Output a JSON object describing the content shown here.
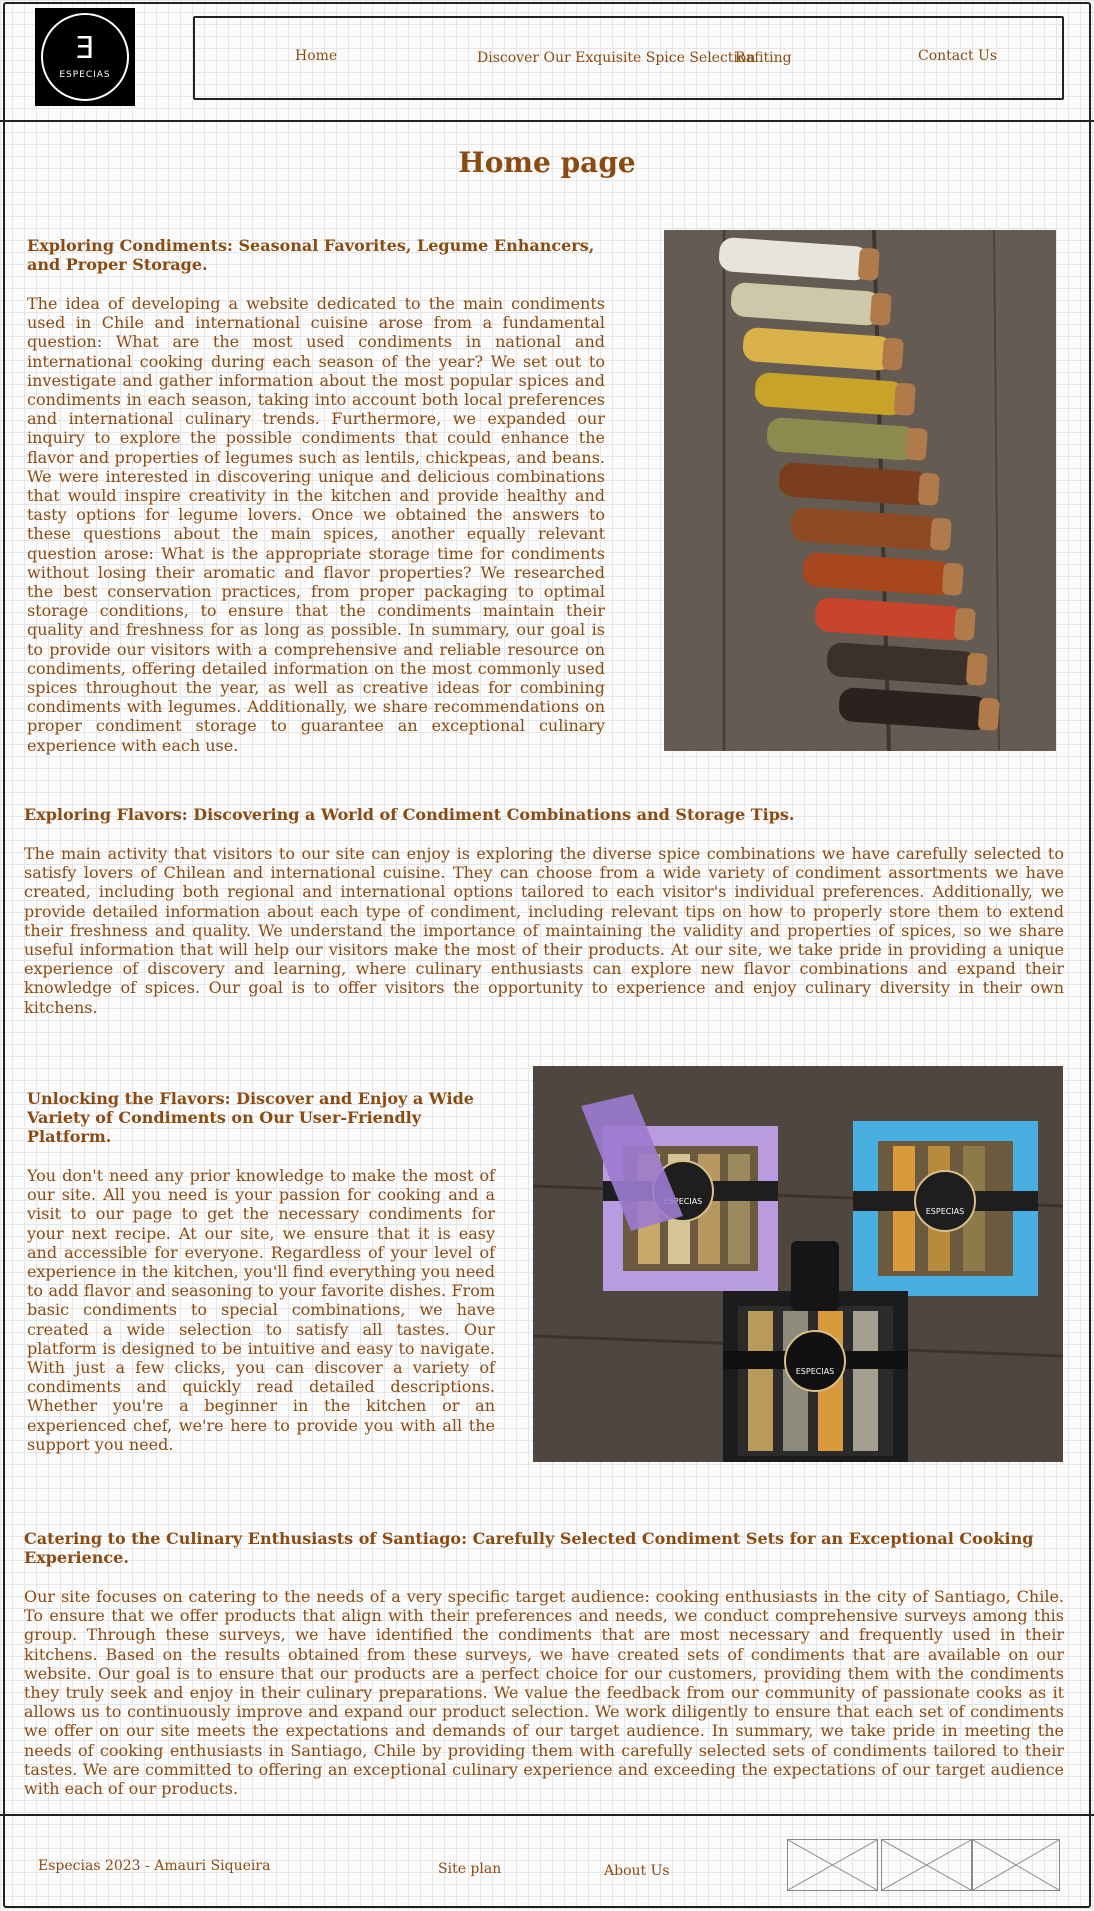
{
  "header": {
    "logo_text": "ESPECIAS",
    "nav": [
      {
        "label": "Home"
      },
      {
        "label": "Discover Our Exquisite Spice Selection"
      },
      {
        "label": "Rafiting"
      },
      {
        "label": "Contact Us"
      }
    ]
  },
  "main": {
    "page_title": "Home page",
    "sections": [
      {
        "title": "Exploring Condiments: Seasonal Favorites, Legume Enhancers, and Proper Storage.",
        "body": "The idea of developing a website dedicated to the main condiments used in Chile and international cuisine arose from a fundamental question: What are the most used condiments in national and international cooking during each season of the year? We set out to investigate and gather information about the most popular spices and condiments in each season, taking into account both local preferences and international culinary trends. Furthermore, we expanded our inquiry to explore the possible condiments that could enhance the flavor and properties of legumes such as lentils, chickpeas, and beans. We were interested in discovering unique and delicious combinations that would inspire creativity in the kitchen and provide healthy and tasty options for legume lovers. Once we obtained the answers to these questions about the main spices, another equally relevant question arose: What is the appropriate storage time for condiments without losing their aromatic and flavor properties? We researched the best conservation practices, from proper packaging to optimal storage conditions, to ensure that the condiments maintain their quality and freshness for as long as possible. In summary, our goal is to provide our visitors with a comprehensive and reliable resource on condiments, offering detailed information on the most commonly used spices throughout the year, as well as creative ideas for combining condiments with legumes. Additionally, we share recommendations on proper condiment storage to guarantee an exceptional culinary experience with each use."
      },
      {
        "title": "Exploring Flavors: Discovering a World of Condiment Combinations and Storage Tips.",
        "body": "The main activity that visitors to our site can enjoy is exploring the diverse spice combinations we have carefully selected to satisfy lovers of Chilean and international cuisine. They can choose from a wide variety of condiment assortments we have created, including both regional and international options tailored to each visitor's individual preferences. Additionally, we provide detailed information about each type of condiment, including relevant tips on how to properly store them to extend their freshness and quality. We understand the importance of maintaining the validity and properties of spices, so we share useful information that will help our visitors make the most of their products. At our site, we take pride in providing a unique experience of discovery and learning, where culinary enthusiasts can explore new flavor combinations and expand their knowledge of spices. Our goal is to offer visitors the opportunity to experience and enjoy culinary diversity in their own kitchens."
      },
      {
        "title": "Unlocking the Flavors: Discover and Enjoy a Wide Variety of Condiments on Our User-Friendly Platform.",
        "body": "You don't need any prior knowledge to make the most of our site. All you need is your passion for cooking and a visit to our page to get the necessary condiments for your next recipe. At our site, we ensure that it is easy and accessible for everyone. Regardless of your level of experience in the kitchen, you'll find everything you need to add flavor and seasoning to your favorite dishes. From basic condiments to special combinations, we have created a wide selection to satisfy all tastes. Our platform is designed to be intuitive and easy to navigate. With just a few clicks, you can discover a variety of condiments and quickly read detailed descriptions. Whether you're a beginner in the kitchen or an experienced chef, we're here to provide you with all the support you need."
      },
      {
        "title": "Catering to the Culinary Enthusiasts of Santiago: Carefully Selected Condiment Sets for an Exceptional Cooking Experience.",
        "body": "Our site focuses on catering to the needs of a very specific target audience: cooking enthusiasts in the city of Santiago, Chile. To ensure that we offer products that align with their preferences and needs, we conduct comprehensive surveys among this group. Through these surveys, we have identified the condiments that are most necessary and frequently used in their kitchens. Based on the results obtained from these surveys, we have created sets of condiments that are available on our website. Our goal is to ensure that our products are a perfect choice for our customers, providing them with the condiments they truly seek and enjoy in their culinary preparations. We value the feedback from our community of passionate cooks as it allows us to continuously improve and expand our product selection. We work diligently to ensure that each set of condiments we offer on our site meets the expectations and demands of our target audience. In summary, we take pride in meeting the needs of cooking enthusiasts in Santiago, Chile by providing them with carefully selected sets of condiments tailored to their tastes. We are committed to offering an exceptional culinary experience and exceeding the expectations of our target audience with each of our products."
      }
    ],
    "box_labels": [
      "ESPECIAS",
      "ESPECIAS",
      "ESPECIAS"
    ]
  },
  "footer": {
    "copyright": "Especias  2023 - Amauri Siqueira",
    "site_plan": "Site plan",
    "about": "About Us"
  },
  "colors": {
    "text": "#8a4b12",
    "background": "#fbfbfb"
  }
}
